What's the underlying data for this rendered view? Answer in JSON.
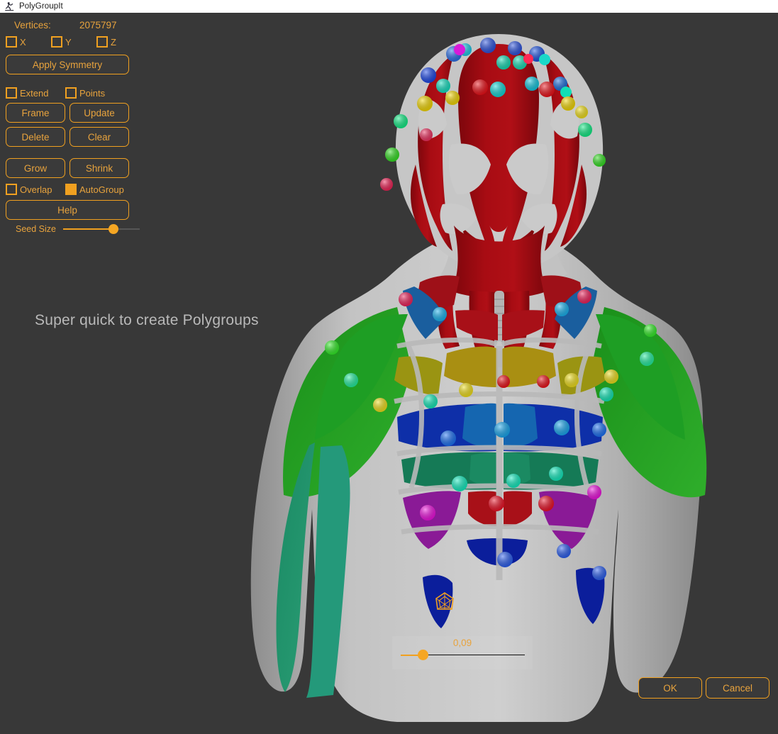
{
  "window": {
    "title": "PolyGroupIt",
    "icon": "figure-icon"
  },
  "theme": {
    "accent": "#F0A020",
    "accent_text": "#E8A33D",
    "panel_bg": "#383838",
    "viewport_bg": "#383838",
    "titlebar_bg": "#FFFFFF",
    "caption_color": "#B9B9B9"
  },
  "toolpanel": {
    "vertices_label": "Vertices:",
    "vertices_value": "2075797",
    "axes": [
      {
        "label": "X",
        "checked": false
      },
      {
        "label": "Y",
        "checked": false
      },
      {
        "label": "Z",
        "checked": false
      }
    ],
    "apply_symmetry_label": "Apply Symmetry",
    "options_row1": [
      {
        "label": "Extend",
        "checked": false
      },
      {
        "label": "Points",
        "checked": false
      }
    ],
    "buttons_grid1": [
      "Frame",
      "Update",
      "Delete",
      "Clear"
    ],
    "buttons_grid2": [
      "Grow",
      "Shrink"
    ],
    "options_row2": [
      {
        "label": "Overlap",
        "checked": false
      },
      {
        "label": "AutoGroup",
        "checked": true
      }
    ],
    "help_label": "Help",
    "seed_size_label": "Seed Size",
    "seed_size_percent": 66
  },
  "caption": {
    "text": "Super quick to create Polygroups"
  },
  "value_slider": {
    "value": "0,09",
    "fill_percent": 18
  },
  "footer": {
    "ok_label": "OK",
    "cancel_label": "Cancel"
  },
  "viewport": {
    "subject": "anatomical male bust with polygroups",
    "background": "#383838",
    "body_gray": "#BDBDBD",
    "muscle_red": "#A00A10",
    "brush_cursor_color": "#F0A020",
    "polygroup_colors": [
      "#1E9E1E",
      "#1B7A52",
      "#0E2FA8",
      "#1566B0",
      "#9A8A10",
      "#7A1A8A",
      "#A00A10",
      "#1B8A62",
      "#C8C800",
      "#0B1E9B"
    ],
    "seed_marker_colors": [
      "#30E030",
      "#2BE8A0",
      "#F2E000",
      "#FF2A55",
      "#2AA8F0",
      "#1030E0",
      "#EE1020",
      "#F000E0",
      "#00E0C0",
      "#FFD000"
    ]
  }
}
